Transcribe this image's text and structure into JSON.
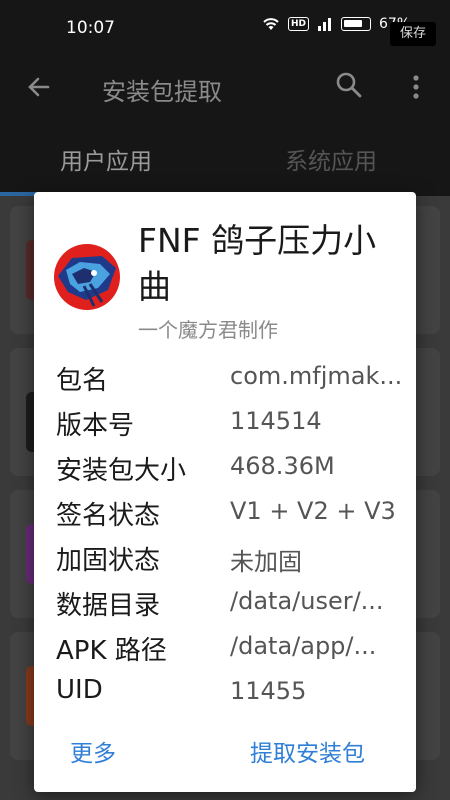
{
  "status_bar": {
    "time": "10:07",
    "hd_badge": "HD",
    "signal_label": "4G",
    "battery": "67%",
    "save_toast": "保存"
  },
  "toolbar": {
    "title": "安装包提取"
  },
  "tabs": [
    {
      "label": "用户应用"
    },
    {
      "label": "系统应用"
    }
  ],
  "dialog": {
    "app_name": "FNF 鸽子压力小曲",
    "app_desc": "一个魔方君制作",
    "rows": [
      {
        "label": "包名",
        "value": "com.mfjmak..."
      },
      {
        "label": "版本号",
        "value": "114514"
      },
      {
        "label": "安装包大小",
        "value": "468.36M"
      },
      {
        "label": "签名状态",
        "value": "V1 + V2 + V3"
      },
      {
        "label": "加固状态",
        "value": "未加固"
      },
      {
        "label": "数据目录",
        "value": "/data/user/..."
      },
      {
        "label": "APK 路径",
        "value": "/data/app/..."
      },
      {
        "label": "UID",
        "value": "11455"
      }
    ],
    "btn_more": "更多",
    "btn_extract": "提取安装包"
  },
  "colors": {
    "accent": "#2f7fd6",
    "toolbar_bg": "#161616",
    "tab_indicator": "#2a66a0"
  }
}
